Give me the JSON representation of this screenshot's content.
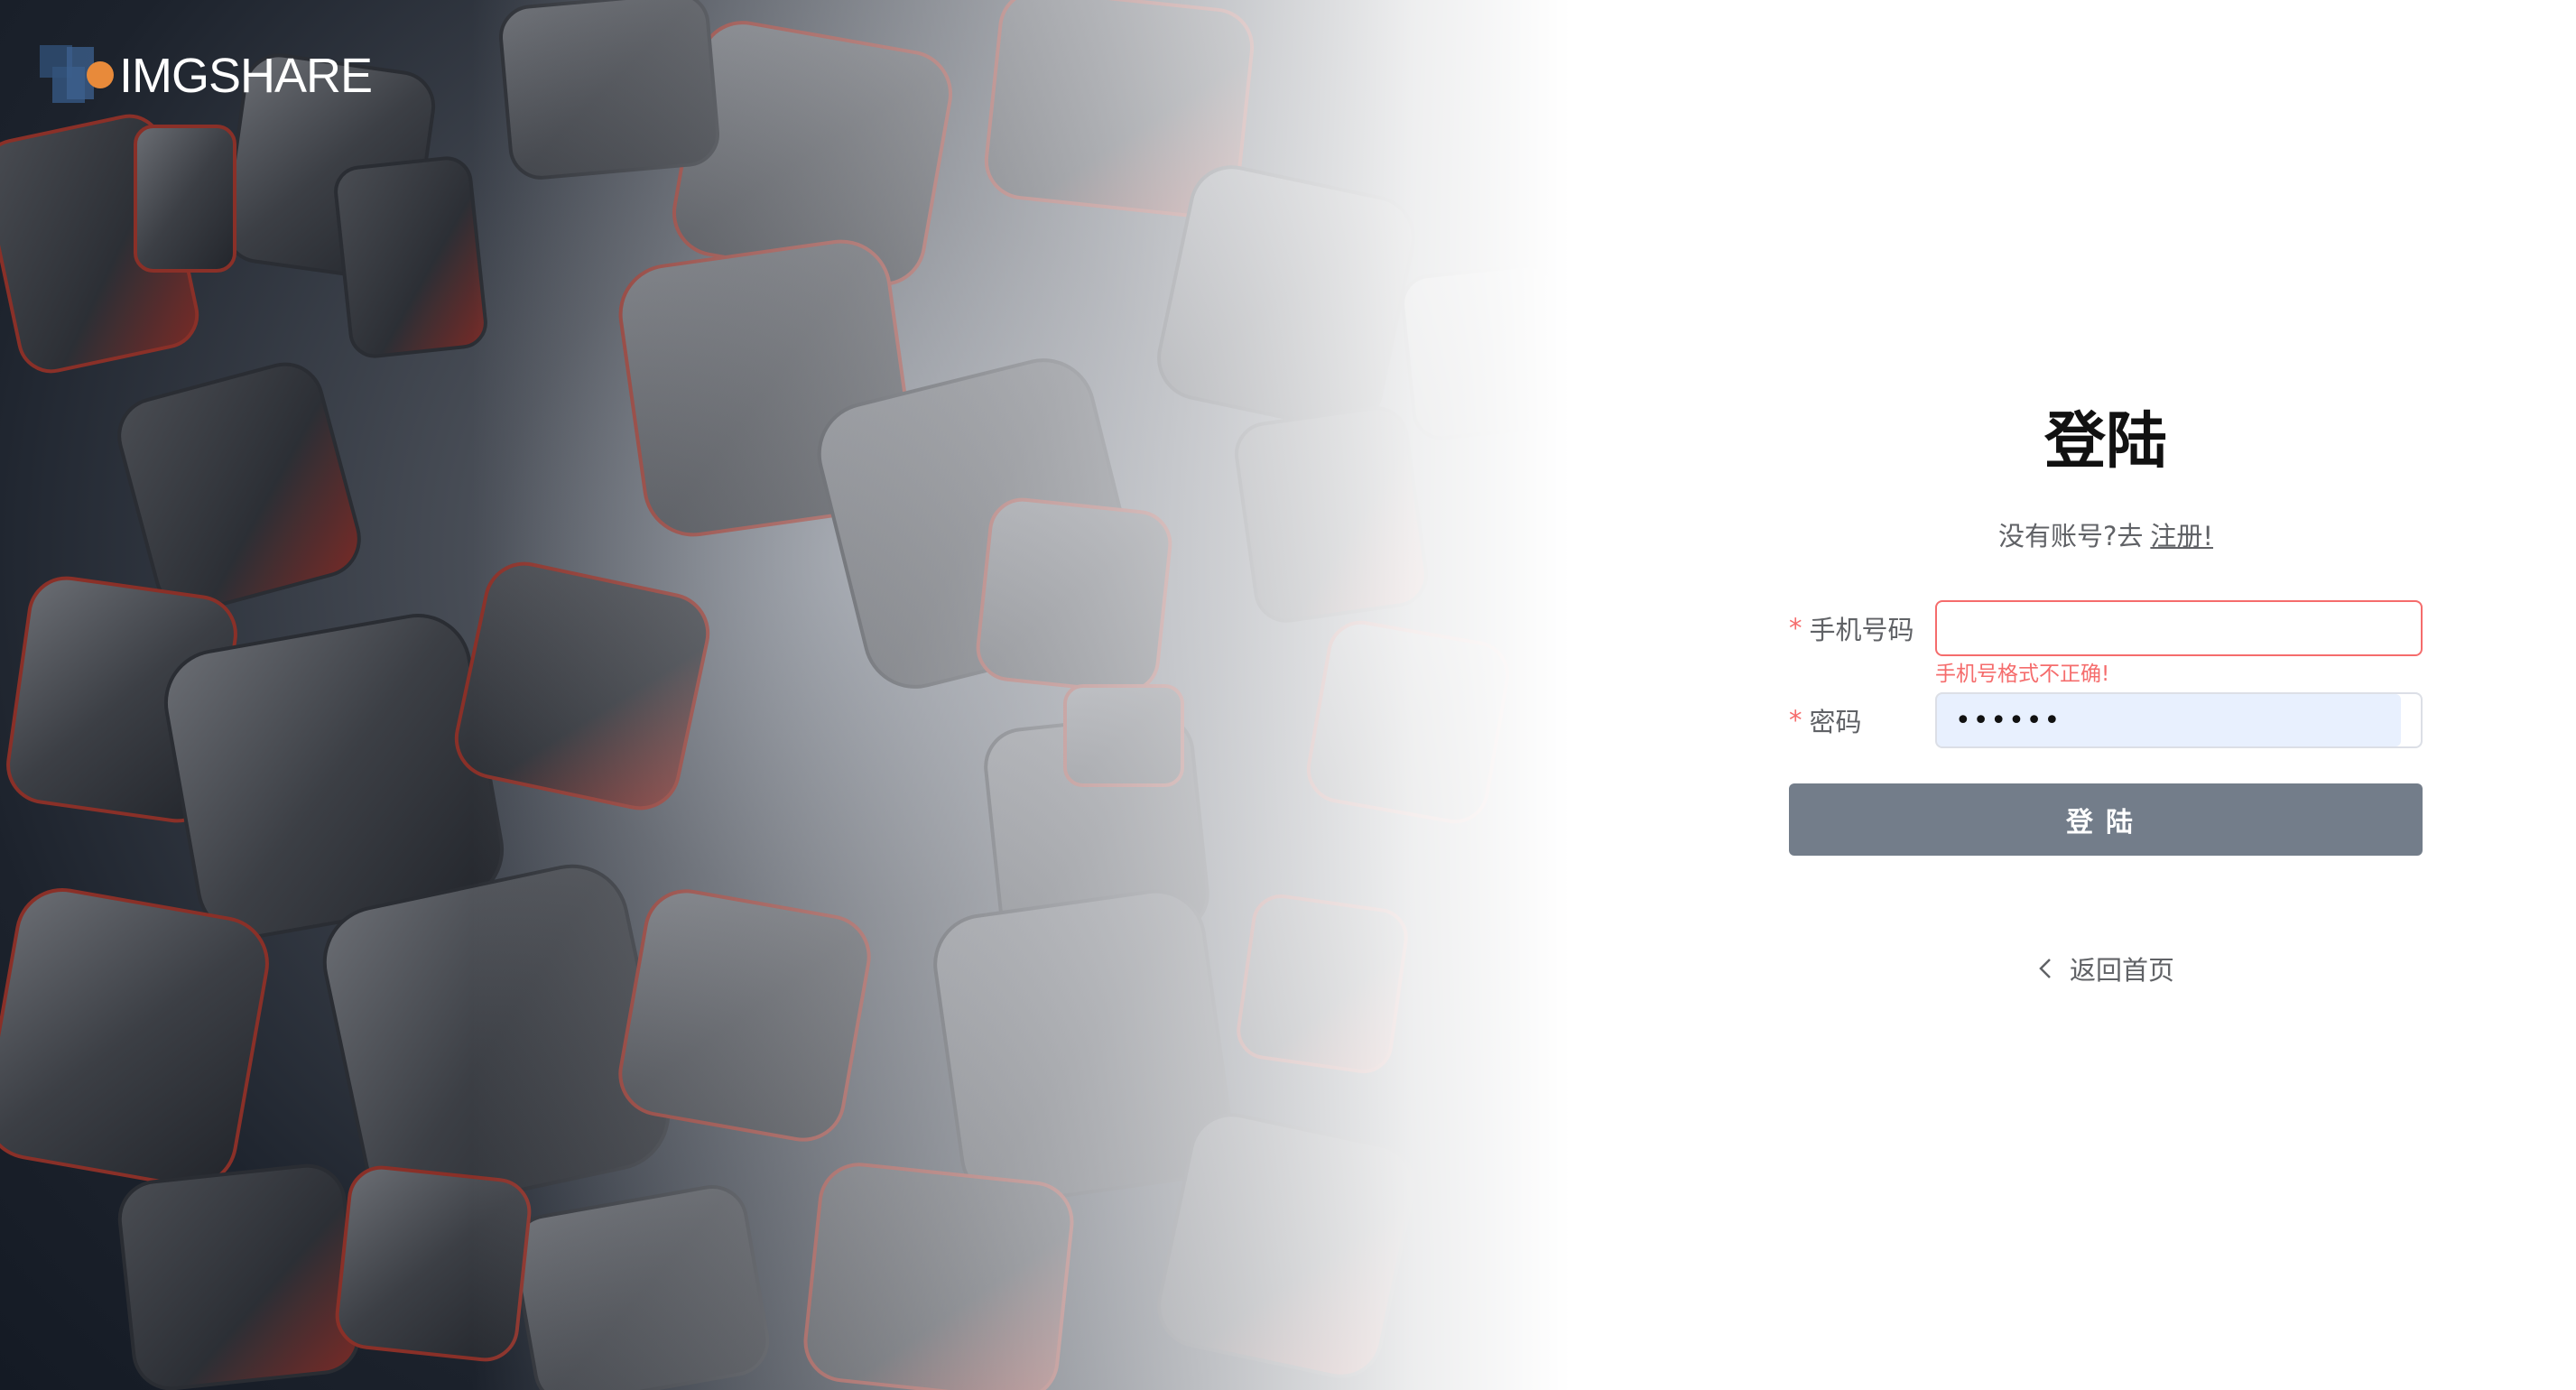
{
  "brand": {
    "logo_text": "IMGSHARE"
  },
  "login": {
    "title": "登陆",
    "register_prompt": "没有账号?去",
    "register_link": "注册!",
    "fields": {
      "phone": {
        "label": "手机号码",
        "required_mark": "*",
        "value": "",
        "error": "手机号格式不正确!"
      },
      "password": {
        "label": "密码",
        "required_mark": "*",
        "value": "••••••"
      }
    },
    "submit_label": "登陆",
    "back_home": "返回首页"
  },
  "colors": {
    "error": "#f56c6c",
    "button": "#737d8a",
    "autofill": "#e8f0fe",
    "logo_dot": "#e88a3a"
  },
  "icons": {
    "back": "chevron-left-icon"
  }
}
